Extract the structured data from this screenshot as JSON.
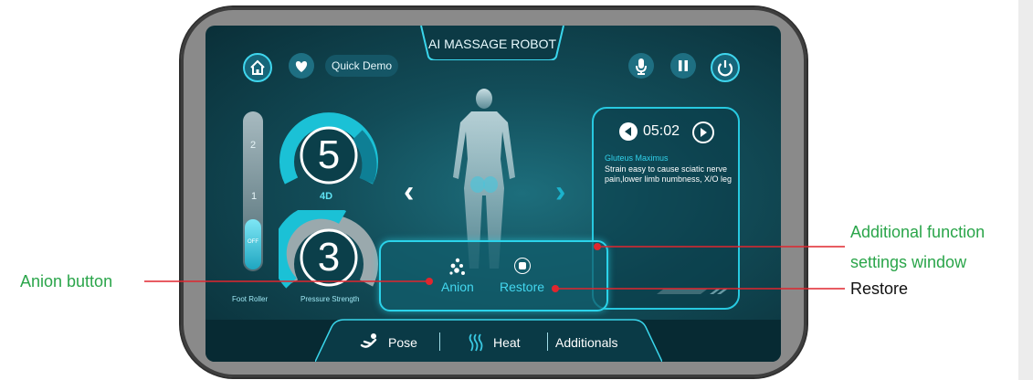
{
  "app": {
    "title": "AI MASSAGE ROBOT"
  },
  "header": {
    "quick_demo_label": "Quick Demo",
    "icons": [
      "home-icon",
      "heart-icon",
      "microphone-icon",
      "pause-icon",
      "power-icon"
    ]
  },
  "left_controls": {
    "slider_levels": [
      "2",
      "1",
      "OFF"
    ],
    "foot_roller_label": "Foot Roller",
    "mode_gauge": {
      "value": "5",
      "label": "4D"
    },
    "pressure_gauge": {
      "value": "3",
      "label": "Pressure Strength"
    }
  },
  "info_panel": {
    "time": "05:02",
    "muscle_name": "Gluteus Maximus",
    "description": "Strain easy to cause sciatic nerve pain,lower limb numbness, X/O leg"
  },
  "function_window": {
    "anion_label": "Anion",
    "restore_label": "Restore"
  },
  "bottom_nav": {
    "pose_label": "Pose",
    "heat_label": "Heat",
    "additionals_label": "Additionals"
  },
  "annotations": {
    "anion_button": "Anion button",
    "additional_function_line1": "Additional function",
    "additional_function_line2": "settings window",
    "restore": "Restore"
  },
  "colors": {
    "accent": "#2bd3ea",
    "annotation_green": "#2aa54a",
    "pointer_red": "#e0262e"
  }
}
